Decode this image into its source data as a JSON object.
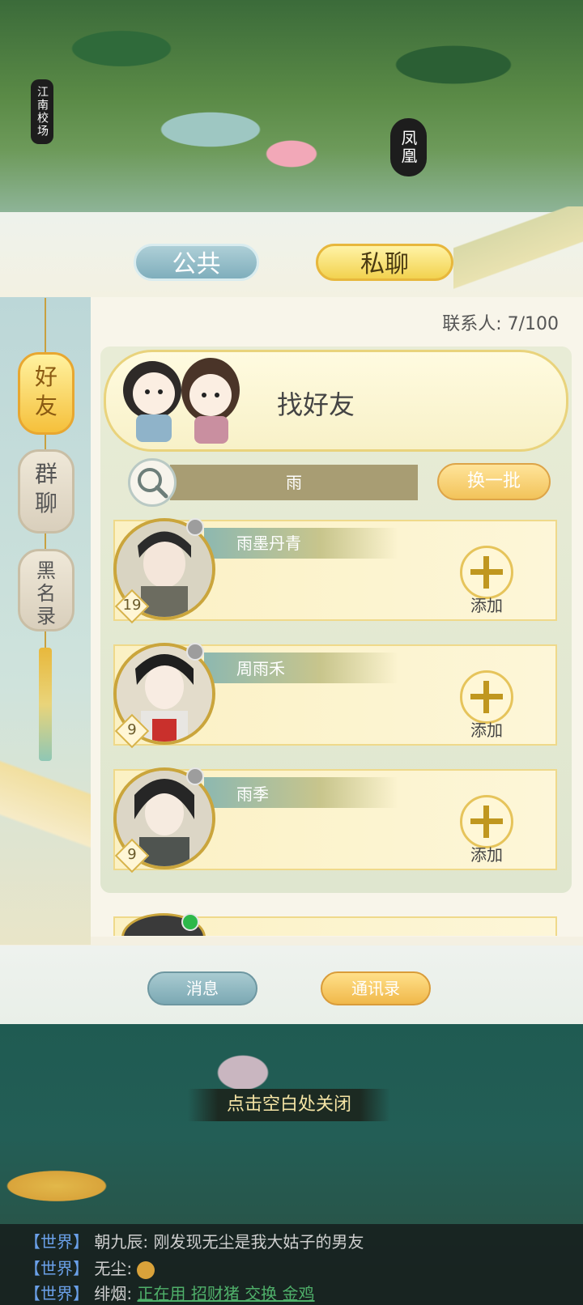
{
  "scene": {
    "left_sign": "江南校场",
    "right_sign": "凤凰"
  },
  "tabs": {
    "public": "公共",
    "private": "私聊"
  },
  "sidebar": {
    "friends": "好友",
    "groups": "群聊",
    "blacklist": "黑名录"
  },
  "contacts_label": "联系人: 7/100",
  "find_friends": {
    "title": "找好友",
    "search_value": "雨",
    "refresh_label": "换一批"
  },
  "results": [
    {
      "name": "雨墨丹青",
      "level": "19",
      "add_label": "添加",
      "online": false
    },
    {
      "name": "周雨禾",
      "level": "9",
      "add_label": "添加",
      "online": false
    },
    {
      "name": "雨季",
      "level": "9",
      "add_label": "添加",
      "online": false
    },
    {
      "name": "",
      "level": "",
      "add_label": "",
      "online": true
    }
  ],
  "bottom": {
    "messages": "消息",
    "address_book": "通讯录"
  },
  "close_hint": "点击空白处关闭",
  "chat": [
    {
      "channel": "【世界】",
      "speaker": "朝九辰:",
      "text": "刚发现无尘是我大姑子的男友"
    },
    {
      "channel": "【世界】",
      "speaker": "无尘:",
      "text": ""
    },
    {
      "channel": "【世界】",
      "speaker": "绯烟:",
      "text": "正在用 招财猪 交换 金鸡"
    }
  ],
  "colors": {
    "accent_gold": "#f2c35a",
    "teal": "#7faebc",
    "online": "#2db84a",
    "offline": "#9d9d9d"
  }
}
